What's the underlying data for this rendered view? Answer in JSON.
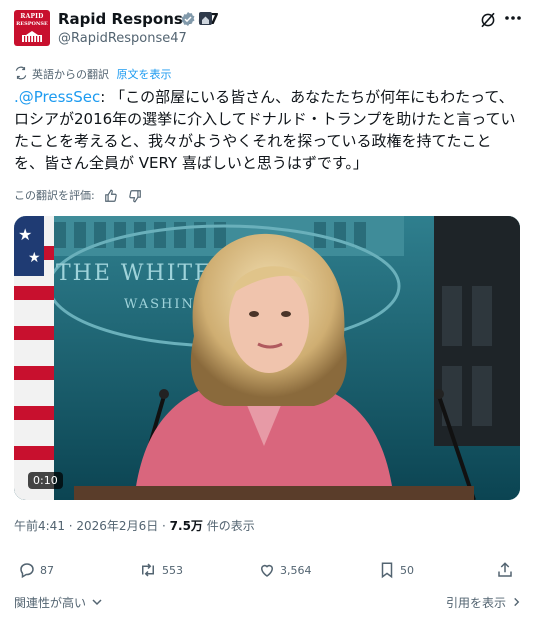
{
  "account": {
    "display_name": "Rapid Response 47",
    "handle": "@RapidResponse47",
    "avatar_line1": "RAPID",
    "avatar_line2": "RESPONSE",
    "avatar_color": "#c8102e"
  },
  "translation": {
    "label": "英語からの翻訳",
    "show_original": "原文を表示",
    "rate_label": "この翻訳を評価:"
  },
  "post": {
    "mention": ".@PressSec",
    "text": ": 「この部屋にいる皆さん、あなたたちが何年にもわたって、ロシアが2016年の選挙に介入してドナルド・トランプを助けたと言っていたことを考えると、我々がようやくそれを探っている政権を持てたことを、皆さん全員が VERY 喜ばしいと思うはずです。」"
  },
  "media": {
    "duration": "0:10",
    "backdrop_text": "THE WHITE HOUSE",
    "backdrop_sub": "WASHINGTON"
  },
  "meta": {
    "time": "午前4:41 · 2026年2月6日 · ",
    "views": "7.5万",
    "views_suffix": " 件の表示"
  },
  "actions": {
    "replies": "87",
    "reposts": "553",
    "likes": "3,564",
    "bookmarks": "50"
  },
  "footer": {
    "sort": "関連性が高い",
    "quotes": "引用を表示"
  },
  "colors": {
    "accent": "#1d9bf0",
    "secondary_text": "#536471",
    "verified": "#829aab"
  }
}
